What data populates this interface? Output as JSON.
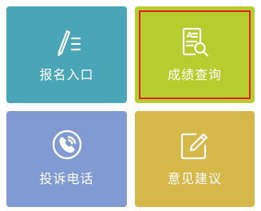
{
  "tiles": [
    {
      "label": "报名入口",
      "icon": "pen-list-icon",
      "color": "#4aa5b6"
    },
    {
      "label": "成绩查询",
      "icon": "document-search-icon",
      "color": "#b7cc2e",
      "highlighted": true,
      "highlight_color": "#e0201c"
    },
    {
      "label": "投诉电话",
      "icon": "phone-icon",
      "color": "#7f9bd0"
    },
    {
      "label": "意见建议",
      "icon": "edit-note-icon",
      "color": "#d6b84a"
    }
  ]
}
